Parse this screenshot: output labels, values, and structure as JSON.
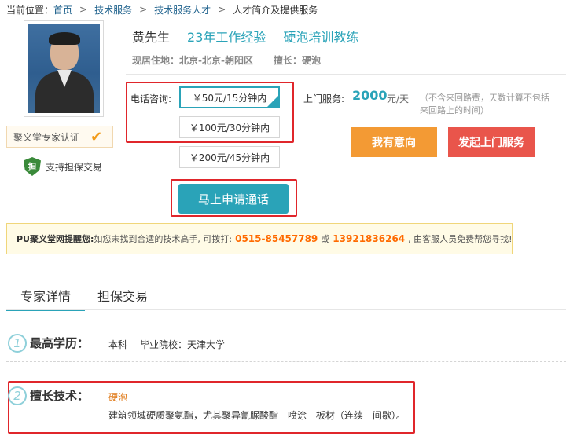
{
  "breadcrumb": {
    "prefix": "当前位置：",
    "items": [
      "首页",
      "技术服务",
      "技术服务人才",
      "人才简介及提供服务"
    ],
    "separator": ">"
  },
  "profile": {
    "name": "黄先生",
    "experience": "23年工作经验",
    "role": "硬泡培训教练",
    "location_label": "现居住地：",
    "location_value": "北京-北京-朝阳区",
    "specialty_label": "擅长：",
    "specialty_value": "硬泡",
    "cert_label": "聚义堂专家认证",
    "guarantee_icon_text": "担",
    "guarantee_label": "支持担保交易"
  },
  "phone_consult": {
    "label": "电话咨询:",
    "options": [
      "￥50元/15分钟内",
      "￥100元/30分钟内",
      "￥200元/45分钟内"
    ],
    "selected_index": 0,
    "call_button": "马上申请通话"
  },
  "home_service": {
    "label": "上门服务:",
    "price": "2000",
    "unit": "元/天",
    "note": "（不含来回路费，天数计算不包括来回路上的时间）",
    "interest_button": "我有意向",
    "start_button": "发起上门服务"
  },
  "reminder": {
    "title": "PU聚义堂网提醒您:",
    "text_before": "如您未找到合适的技术高手, 可拨打:",
    "phone1": "0515-85457789",
    "or": "或",
    "phone2": "13921836264",
    "text_after": ", 由客服人员免费帮您寻找!"
  },
  "tabs": [
    "专家详情",
    "担保交易"
  ],
  "sections": {
    "education": {
      "number": "1",
      "title": "最高学历：",
      "degree": "本科",
      "school": "毕业院校：天津大学"
    },
    "skills": {
      "number": "2",
      "title": "擅长技术：",
      "tag": "硬泡",
      "description": "建筑领域硬质聚氨酯，尤其聚异氰脲酸酯 - 喷涂 - 板材（连续 - 间歇）。"
    }
  },
  "colors": {
    "accent": "#2aa3b8",
    "orange": "#f39a34",
    "red_button": "#e9554b",
    "highlight_border": "#e0262b"
  }
}
